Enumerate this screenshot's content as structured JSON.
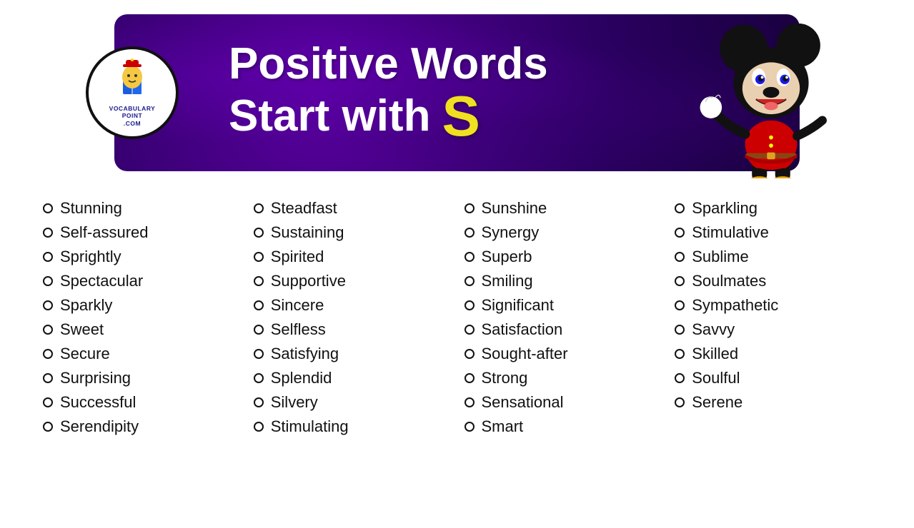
{
  "header": {
    "title_line1": "Positive Words",
    "title_line2": "Start with",
    "title_letter": "S",
    "logo": {
      "text_line1": "VOCABULARY",
      "text_line2": "POINT",
      "text_line3": ".COM"
    }
  },
  "columns": [
    {
      "id": "col1",
      "words": [
        "Stunning",
        "Self-assured",
        "Sprightly",
        "Spectacular",
        "Sparkly",
        "Sweet",
        "Secure",
        "Surprising",
        "Successful",
        "Serendipity"
      ]
    },
    {
      "id": "col2",
      "words": [
        "Steadfast",
        "Sustaining",
        "Spirited",
        "Supportive",
        "Sincere",
        "Selfless",
        "Satisfying",
        "Splendid",
        "Silvery",
        "Stimulating"
      ]
    },
    {
      "id": "col3",
      "words": [
        "Sunshine",
        "Synergy",
        "Superb",
        "Smiling",
        "Significant",
        "Satisfaction",
        "Sought-after",
        "Strong",
        "Sensational",
        "Smart"
      ]
    },
    {
      "id": "col4",
      "words": [
        "Sparkling",
        "Stimulative",
        "Sublime",
        "Soulmates",
        "Sympathetic",
        "Savvy",
        "Skilled",
        "Soulful",
        "Serene"
      ]
    }
  ]
}
